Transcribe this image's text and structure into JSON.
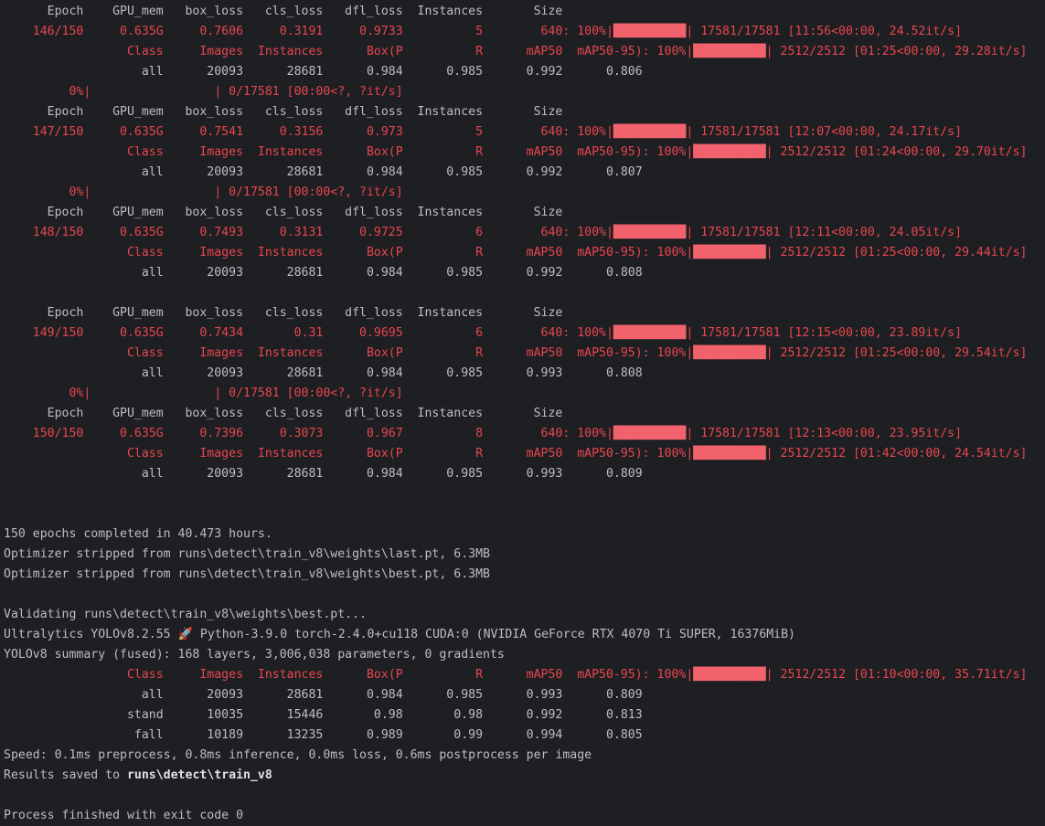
{
  "terminal": {
    "title": "PyCharm Run console — YOLOv8 training output",
    "colors": {
      "background": "#1E1F22",
      "stdout_text": "#BCBEC4",
      "stderr_text": "#E8464F",
      "progress_bar": "#F2626C",
      "bold_text": "#DFE1E5"
    },
    "font_size_px": 13,
    "line_height_px": 22
  },
  "headers": {
    "train": "      Epoch    GPU_mem   box_loss   cls_loss   dfl_loss  Instances       Size",
    "val": "                 Class     Images  Instances      Box(P          R      mAP50  mAP50-95): ",
    "val_plain": "                 Class     Images  Instances      Box(P          R      mAP50  mAP50-95)"
  },
  "epochs": [
    {
      "epoch": "146/150",
      "gpu_mem": "0.635G",
      "box_loss": "0.7606",
      "cls_loss": "0.3191",
      "dfl_loss": "0.9733",
      "instances": "5",
      "size": "640",
      "train_pct": "100%",
      "train_count": "17581/17581",
      "train_timing": "[11:56<00:00, 24.52it/s]",
      "val_pct": "100%",
      "val_count": "2512/2512",
      "val_timing": "[01:25<00:00, 29.28it/s]",
      "val_row": {
        "class": "all",
        "images": "20093",
        "instances": "28681",
        "box_p": "0.984",
        "r": "0.985",
        "map50": "0.992",
        "map50_95": "0.806"
      },
      "next_bar": "         0%|                 | 0/17581 [00:00<?, ?it/s]",
      "has_next_bar": true,
      "has_blank_after": false
    },
    {
      "epoch": "147/150",
      "gpu_mem": "0.635G",
      "box_loss": "0.7541",
      "cls_loss": "0.3156",
      "dfl_loss": "0.973",
      "instances": "5",
      "size": "640",
      "train_pct": "100%",
      "train_count": "17581/17581",
      "train_timing": "[12:07<00:00, 24.17it/s]",
      "val_pct": "100%",
      "val_count": "2512/2512",
      "val_timing": "[01:24<00:00, 29.70it/s]",
      "val_row": {
        "class": "all",
        "images": "20093",
        "instances": "28681",
        "box_p": "0.984",
        "r": "0.985",
        "map50": "0.992",
        "map50_95": "0.807"
      },
      "next_bar": "         0%|                 | 0/17581 [00:00<?, ?it/s]",
      "has_next_bar": true,
      "has_blank_after": false
    },
    {
      "epoch": "148/150",
      "gpu_mem": "0.635G",
      "box_loss": "0.7493",
      "cls_loss": "0.3131",
      "dfl_loss": "0.9725",
      "instances": "6",
      "size": "640",
      "train_pct": "100%",
      "train_count": "17581/17581",
      "train_timing": "[12:11<00:00, 24.05it/s]",
      "val_pct": "100%",
      "val_count": "2512/2512",
      "val_timing": "[01:25<00:00, 29.44it/s]",
      "val_row": {
        "class": "all",
        "images": "20093",
        "instances": "28681",
        "box_p": "0.984",
        "r": "0.985",
        "map50": "0.992",
        "map50_95": "0.808"
      },
      "next_bar": "",
      "has_next_bar": false,
      "has_blank_after": true
    },
    {
      "epoch": "149/150",
      "gpu_mem": "0.635G",
      "box_loss": "0.7434",
      "cls_loss": "0.31",
      "dfl_loss": "0.9695",
      "instances": "6",
      "size": "640",
      "train_pct": "100%",
      "train_count": "17581/17581",
      "train_timing": "[12:15<00:00, 23.89it/s]",
      "val_pct": "100%",
      "val_count": "2512/2512",
      "val_timing": "[01:25<00:00, 29.54it/s]",
      "val_row": {
        "class": "all",
        "images": "20093",
        "instances": "28681",
        "box_p": "0.984",
        "r": "0.985",
        "map50": "0.993",
        "map50_95": "0.808"
      },
      "next_bar": "         0%|                 | 0/17581 [00:00<?, ?it/s]",
      "has_next_bar": true,
      "has_blank_after": false
    },
    {
      "epoch": "150/150",
      "gpu_mem": "0.635G",
      "box_loss": "0.7396",
      "cls_loss": "0.3073",
      "dfl_loss": "0.967",
      "instances": "8",
      "size": "640",
      "train_pct": "100%",
      "train_count": "17581/17581",
      "train_timing": "[12:13<00:00, 23.95it/s]",
      "val_pct": "100%",
      "val_count": "2512/2512",
      "val_timing": "[01:42<00:00, 24.54it/s]",
      "val_row": {
        "class": "all",
        "images": "20093",
        "instances": "28681",
        "box_p": "0.984",
        "r": "0.985",
        "map50": "0.993",
        "map50_95": "0.809"
      },
      "next_bar": "",
      "has_next_bar": false,
      "has_blank_after": false
    }
  ],
  "summary": {
    "completed": "150 epochs completed in 40.473 hours.",
    "optimizer_last": "Optimizer stripped from runs\\detect\\train_v8\\weights\\last.pt, 6.3MB",
    "optimizer_best": "Optimizer stripped from runs\\detect\\train_v8\\weights\\best.pt, 6.3MB",
    "validating": "Validating runs\\detect\\train_v8\\weights\\best.pt...",
    "ultralytics_prefix": "Ultralytics YOLOv8.2.55 ",
    "rocket_icon": "🚀",
    "ultralytics_suffix": " Python-3.9.0 torch-2.4.0+cu118 CUDA:0 (NVIDIA GeForce RTX 4070 Ti SUPER, 16376MiB)",
    "model_summary": "YOLOv8 summary (fused): 168 layers, 3,006,038 parameters, 0 gradients",
    "final_val_pct": "100%",
    "final_val_count": "2512/2512",
    "final_val_timing": "[01:10<00:00, 35.71it/s]",
    "speed": "Speed: 0.1ms preprocess, 0.8ms inference, 0.0ms loss, 0.6ms postprocess per image",
    "results_prefix": "Results saved to ",
    "results_path": "runs\\detect\\train_v8",
    "process_exit": "Process finished with exit code 0"
  },
  "final_metrics": {
    "columns": [
      "Class",
      "Images",
      "Instances",
      "Box(P",
      "R",
      "mAP50",
      "mAP50-95)"
    ],
    "rows": [
      {
        "class": "all",
        "images": "20093",
        "instances": "28681",
        "box_p": "0.984",
        "r": "0.985",
        "map50": "0.993",
        "map50_95": "0.809"
      },
      {
        "class": "stand",
        "images": "10035",
        "instances": "15446",
        "box_p": "0.98",
        "r": "0.98",
        "map50": "0.992",
        "map50_95": "0.813"
      },
      {
        "class": "fall",
        "images": "10189",
        "instances": "13235",
        "box_p": "0.989",
        "r": "0.99",
        "map50": "0.994",
        "map50_95": "0.805"
      }
    ]
  },
  "progress_bar_glyph": "██████████"
}
